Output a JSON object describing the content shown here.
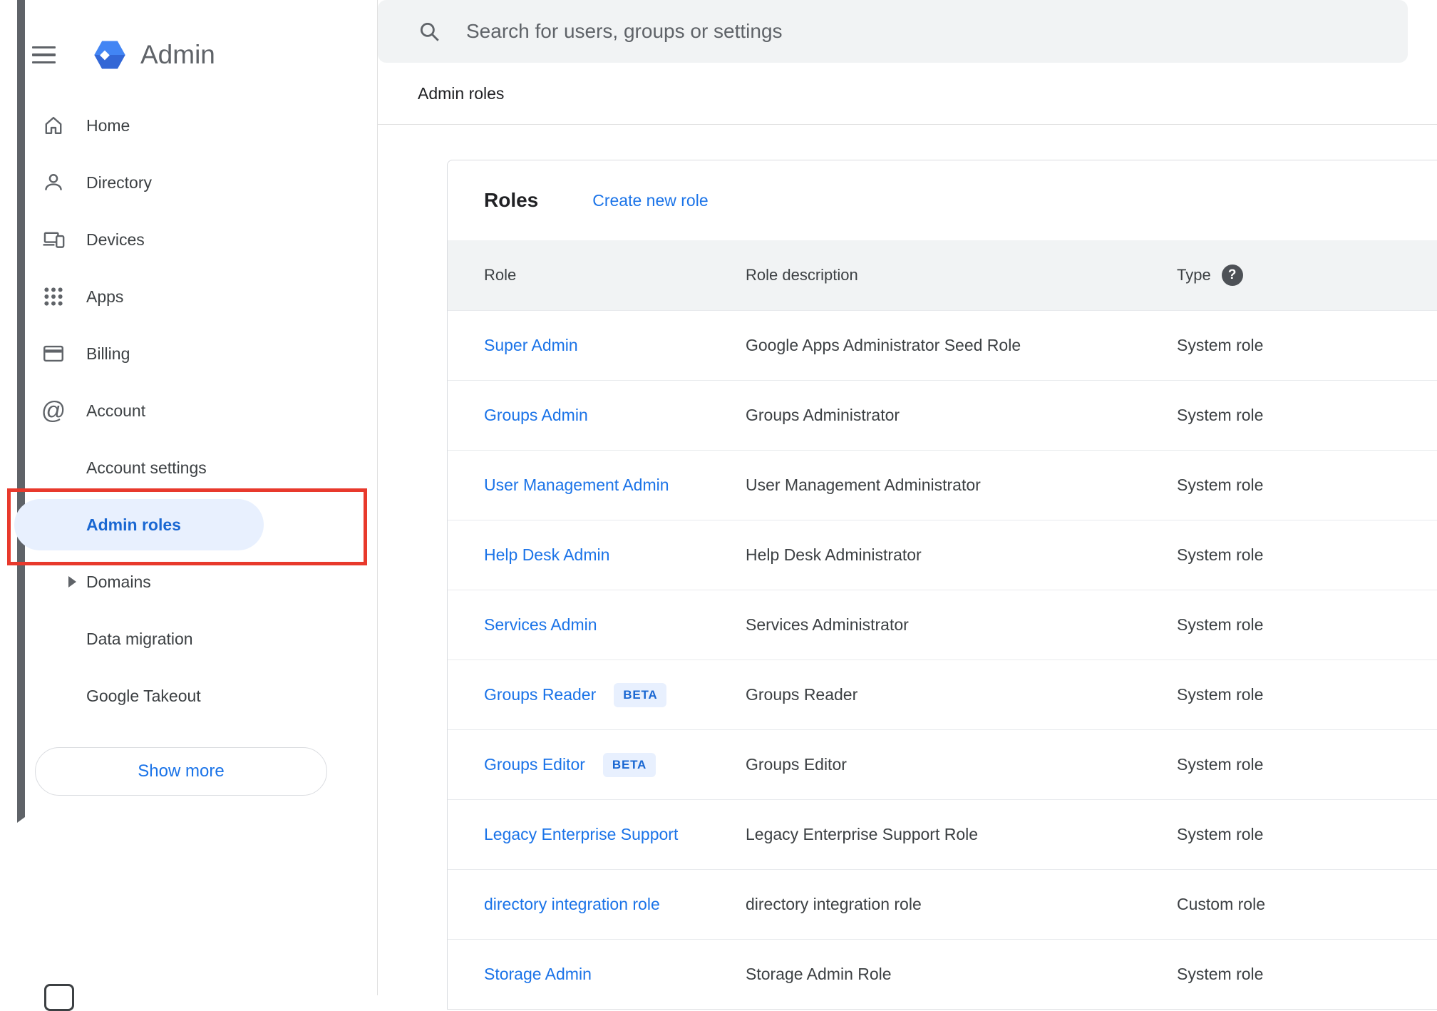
{
  "header": {
    "app_name": "Admin",
    "search_placeholder": "Search for users, groups or settings",
    "breadcrumb": "Admin roles"
  },
  "sidebar": {
    "items": [
      {
        "label": "Home",
        "icon": "home-icon"
      },
      {
        "label": "Directory",
        "icon": "person-icon",
        "state": "collapsed"
      },
      {
        "label": "Devices",
        "icon": "devices-icon",
        "state": "collapsed"
      },
      {
        "label": "Apps",
        "icon": "apps-grid-icon",
        "state": "collapsed"
      },
      {
        "label": "Billing",
        "icon": "credit-card-icon",
        "state": "collapsed"
      },
      {
        "label": "Account",
        "icon": "at-sign-icon",
        "state": "expanded"
      },
      {
        "label": "Account settings",
        "indent": true
      },
      {
        "label": "Admin roles",
        "indent": true,
        "active": true
      },
      {
        "label": "Domains",
        "indent": true,
        "state": "collapsed"
      },
      {
        "label": "Data migration",
        "indent": true
      },
      {
        "label": "Google Takeout",
        "indent": true
      }
    ],
    "show_more_label": "Show more"
  },
  "main": {
    "card": {
      "title": "Roles",
      "create_link": "Create new role",
      "columns": {
        "role": "Role",
        "description": "Role description",
        "type": "Type"
      },
      "rows": [
        {
          "role": "Super Admin",
          "beta": false,
          "description": "Google Apps Administrator Seed Role",
          "type": "System role"
        },
        {
          "role": "Groups Admin",
          "beta": false,
          "description": "Groups Administrator",
          "type": "System role"
        },
        {
          "role": "User Management Admin",
          "beta": false,
          "description": "User Management Administrator",
          "type": "System role"
        },
        {
          "role": "Help Desk Admin",
          "beta": false,
          "description": "Help Desk Administrator",
          "type": "System role"
        },
        {
          "role": "Services Admin",
          "beta": false,
          "description": "Services Administrator",
          "type": "System role"
        },
        {
          "role": "Groups Reader",
          "beta": true,
          "description": "Groups Reader",
          "type": "System role"
        },
        {
          "role": "Groups Editor",
          "beta": true,
          "description": "Groups Editor",
          "type": "System role"
        },
        {
          "role": "Legacy Enterprise Support",
          "beta": false,
          "description": "Legacy Enterprise Support Role",
          "type": "System role"
        },
        {
          "role": "directory integration role",
          "beta": false,
          "description": "directory integration role",
          "type": "Custom role"
        },
        {
          "role": "Storage Admin",
          "beta": false,
          "description": "Storage Admin Role",
          "type": "System role"
        }
      ]
    }
  },
  "labels": {
    "beta": "BETA"
  },
  "colors": {
    "link_blue": "#1a73e8",
    "active_item_text": "#1967d2",
    "active_item_bg": "#e8f0fe",
    "table_header_bg": "#f1f3f4",
    "annotation_red": "#e8392c",
    "logo_blue": "#4285f4"
  }
}
